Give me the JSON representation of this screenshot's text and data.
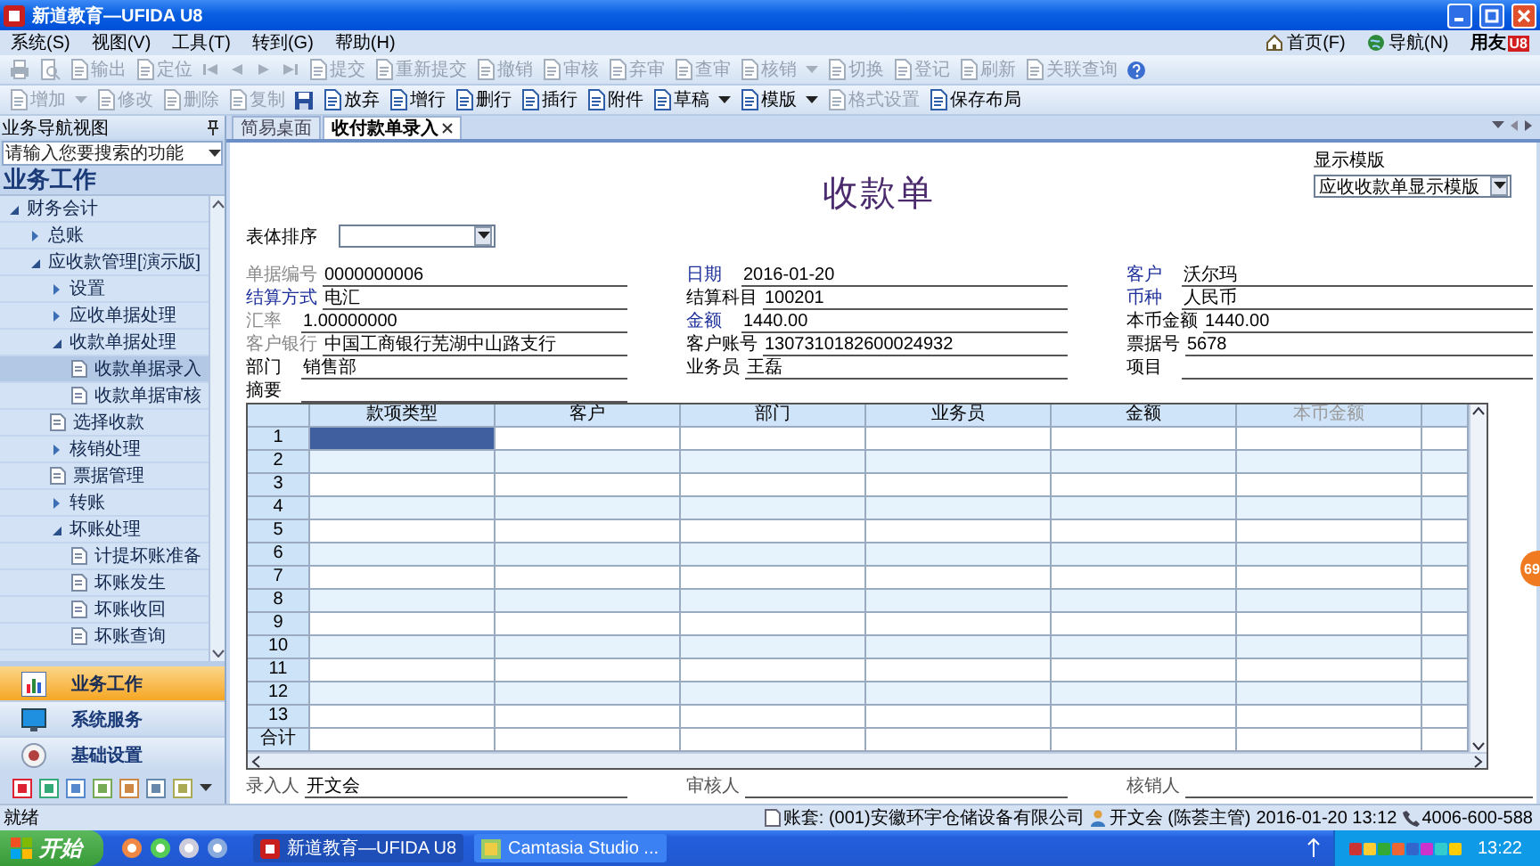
{
  "window": {
    "title": "新道教育—UFIDA U8"
  },
  "menu_bar": {
    "menus": [
      "系统(S)",
      "视图(V)",
      "工具(T)",
      "转到(G)",
      "帮助(H)"
    ],
    "links": [
      "首页(F)",
      "导航(N)"
    ],
    "brand": {
      "name": "用友",
      "mark": "U8"
    }
  },
  "toolbars": [
    {
      "items": [
        {
          "kind": "print",
          "disabled": true
        },
        {
          "kind": "preview",
          "disabled": true
        },
        {
          "kind": "labeled",
          "label": "输出",
          "disabled": true
        },
        {
          "kind": "labeled",
          "label": "定位",
          "disabled": true
        },
        {
          "kind": "first",
          "disabled": true
        },
        {
          "kind": "prev",
          "disabled": true
        },
        {
          "kind": "next",
          "disabled": true
        },
        {
          "kind": "last",
          "disabled": true
        },
        {
          "kind": "labeled",
          "label": "提交",
          "disabled": true
        },
        {
          "kind": "labeled",
          "label": "重新提交",
          "disabled": true
        },
        {
          "kind": "labeled",
          "label": "撤销",
          "disabled": true
        },
        {
          "kind": "labeled",
          "label": "审核",
          "disabled": true
        },
        {
          "kind": "labeled",
          "label": "弃审",
          "disabled": true
        },
        {
          "kind": "labeled",
          "label": "查审",
          "disabled": true
        },
        {
          "kind": "labeled",
          "label": "核销",
          "disabled": true
        },
        {
          "kind": "dropdown",
          "disabled": true
        },
        {
          "kind": "labeled",
          "label": "切换",
          "disabled": true
        },
        {
          "kind": "labeled",
          "label": "登记",
          "disabled": true
        },
        {
          "kind": "labeled",
          "label": "刷新",
          "disabled": true
        },
        {
          "kind": "labeled",
          "label": "关联查询",
          "disabled": true
        },
        {
          "kind": "help",
          "disabled": false
        }
      ]
    },
    {
      "items": [
        {
          "kind": "labeled",
          "label": "增加",
          "disabled": true
        },
        {
          "kind": "dropdown",
          "disabled": true
        },
        {
          "kind": "labeled",
          "label": "修改",
          "disabled": true
        },
        {
          "kind": "labeled",
          "label": "删除",
          "disabled": true
        },
        {
          "kind": "labeled",
          "label": "复制",
          "disabled": true
        },
        {
          "kind": "save",
          "disabled": false
        },
        {
          "kind": "labeled",
          "label": "放弃",
          "disabled": false
        },
        {
          "kind": "labeled",
          "label": "增行",
          "disabled": false
        },
        {
          "kind": "labeled",
          "label": "删行",
          "disabled": false
        },
        {
          "kind": "labeled",
          "label": "插行",
          "disabled": false
        },
        {
          "kind": "labeled",
          "label": "附件",
          "disabled": false
        },
        {
          "kind": "labeled",
          "label": "草稿",
          "disabled": false
        },
        {
          "kind": "dropdown",
          "disabled": false
        },
        {
          "kind": "labeled",
          "label": "模版",
          "disabled": false
        },
        {
          "kind": "dropdown",
          "disabled": false
        },
        {
          "kind": "labeled",
          "label": "格式设置",
          "disabled": true
        },
        {
          "kind": "labeled",
          "label": "保存布局",
          "disabled": false
        }
      ]
    }
  ],
  "sidebar": {
    "title": "业务导航视图",
    "search": {
      "placeholder": "请输入您要搜索的功能"
    },
    "heading": "业务工作",
    "tree": [
      {
        "label": "财务会计",
        "kind": "folder",
        "expanded": true,
        "selected": false,
        "children": [
          {
            "label": "总账",
            "kind": "folder",
            "expanded": false,
            "selected": false
          },
          {
            "label": "应收款管理[演示版]",
            "kind": "folder",
            "expanded": true,
            "selected": false,
            "children": [
              {
                "label": "设置",
                "kind": "folder",
                "expanded": false,
                "selected": false
              },
              {
                "label": "应收单据处理",
                "kind": "folder",
                "expanded": false,
                "selected": false
              },
              {
                "label": "收款单据处理",
                "kind": "folder",
                "expanded": true,
                "selected": false,
                "children": [
                  {
                    "label": "收款单据录入",
                    "kind": "doc",
                    "selected": true
                  },
                  {
                    "label": "收款单据审核",
                    "kind": "doc",
                    "selected": false
                  }
                ]
              },
              {
                "label": "选择收款",
                "kind": "doc",
                "selected": false
              },
              {
                "label": "核销处理",
                "kind": "folder",
                "expanded": false,
                "selected": false
              },
              {
                "label": "票据管理",
                "kind": "doc",
                "selected": false
              },
              {
                "label": "转账",
                "kind": "folder",
                "expanded": false,
                "selected": false
              },
              {
                "label": "坏账处理",
                "kind": "folder",
                "expanded": true,
                "selected": false,
                "children": [
                  {
                    "label": "计提坏账准备",
                    "kind": "doc",
                    "selected": false
                  },
                  {
                    "label": "坏账发生",
                    "kind": "doc",
                    "selected": false
                  },
                  {
                    "label": "坏账收回",
                    "kind": "doc",
                    "selected": false
                  },
                  {
                    "label": "坏账查询",
                    "kind": "doc",
                    "selected": false
                  }
                ]
              }
            ]
          }
        ]
      }
    ],
    "nav": [
      {
        "label": "业务工作",
        "selected": true
      },
      {
        "label": "系统服务",
        "selected": false
      },
      {
        "label": "基础设置",
        "selected": false
      }
    ]
  },
  "tabs": [
    {
      "label": "简易桌面",
      "selected": false,
      "closable": false
    },
    {
      "label": "收付款单录入",
      "selected": true,
      "closable": true
    }
  ],
  "form": {
    "title": "收款单",
    "template": {
      "label": "显示模版",
      "value": "应收收款单显示模版"
    },
    "sort": {
      "label": "表体排序"
    },
    "fields": [
      {
        "label": "单据编号",
        "kind": "locked",
        "value": "0000000006"
      },
      {
        "label": "日期",
        "kind": "ref",
        "value": "2016-01-20"
      },
      {
        "label": "客户",
        "kind": "ref",
        "value": "沃尔玛"
      },
      {
        "label": "结算方式",
        "kind": "ref",
        "value": "电汇"
      },
      {
        "label": "结算科目",
        "kind": "plain",
        "value": "100201"
      },
      {
        "label": "币种",
        "kind": "ref",
        "value": "人民币"
      },
      {
        "label": "汇率",
        "kind": "locked",
        "value": "1.00000000"
      },
      {
        "label": "金额",
        "kind": "ref",
        "value": "1440.00"
      },
      {
        "label": "本币金额",
        "kind": "plain",
        "value": "1440.00"
      },
      {
        "label": "客户银行",
        "kind": "locked",
        "value": "中国工商银行芜湖中山路支行"
      },
      {
        "label": "客户账号",
        "kind": "plain",
        "value": "1307310182600024932"
      },
      {
        "label": "票据号",
        "kind": "plain",
        "value": "5678"
      },
      {
        "label": "部门",
        "kind": "plain",
        "value": "销售部"
      },
      {
        "label": "业务员",
        "kind": "plain",
        "value": "王磊"
      },
      {
        "label": "项目",
        "kind": "plain"
      },
      {
        "label": "摘要",
        "kind": "plain"
      }
    ]
  },
  "grid": {
    "columns": [
      {
        "label": "款项类型",
        "disabled": false
      },
      {
        "label": "客户",
        "disabled": false
      },
      {
        "label": "部门",
        "disabled": false
      },
      {
        "label": "业务员",
        "disabled": false
      },
      {
        "label": "金额",
        "disabled": false
      },
      {
        "label": "本币金额",
        "disabled": true
      }
    ],
    "rows": [
      {
        "label": "1",
        "selected": true
      },
      {
        "label": "2",
        "selected": false
      },
      {
        "label": "3",
        "selected": false
      },
      {
        "label": "4",
        "selected": false
      },
      {
        "label": "5",
        "selected": false
      },
      {
        "label": "6",
        "selected": false
      },
      {
        "label": "7",
        "selected": false
      },
      {
        "label": "8",
        "selected": false
      },
      {
        "label": "9",
        "selected": false
      },
      {
        "label": "10",
        "selected": false
      },
      {
        "label": "11",
        "selected": false
      },
      {
        "label": "12",
        "selected": false
      },
      {
        "label": "13",
        "selected": false
      }
    ],
    "total_label": "合计"
  },
  "signatures": [
    {
      "label": "录入人",
      "value": "开文会"
    },
    {
      "label": "审核人"
    },
    {
      "label": "核销人"
    }
  ],
  "overlay_badge": "69",
  "status_bar": {
    "text": "就绪",
    "items": [
      {
        "kind": "account",
        "label": "账套: (001)安徽环宇仓储设备有限公司"
      },
      {
        "kind": "user",
        "label": "开文会 (陈荟主管)"
      },
      {
        "kind": "date",
        "label": "2016-01-20 13:12"
      },
      {
        "kind": "phone",
        "label": "4006-600-588"
      }
    ]
  },
  "taskbar": {
    "start": "开始",
    "tasks": [
      {
        "label": "新道教育—UFIDA U8",
        "selected": true
      },
      {
        "label": "Camtasia Studio ...",
        "selected": false
      }
    ],
    "clock": "13:22"
  }
}
